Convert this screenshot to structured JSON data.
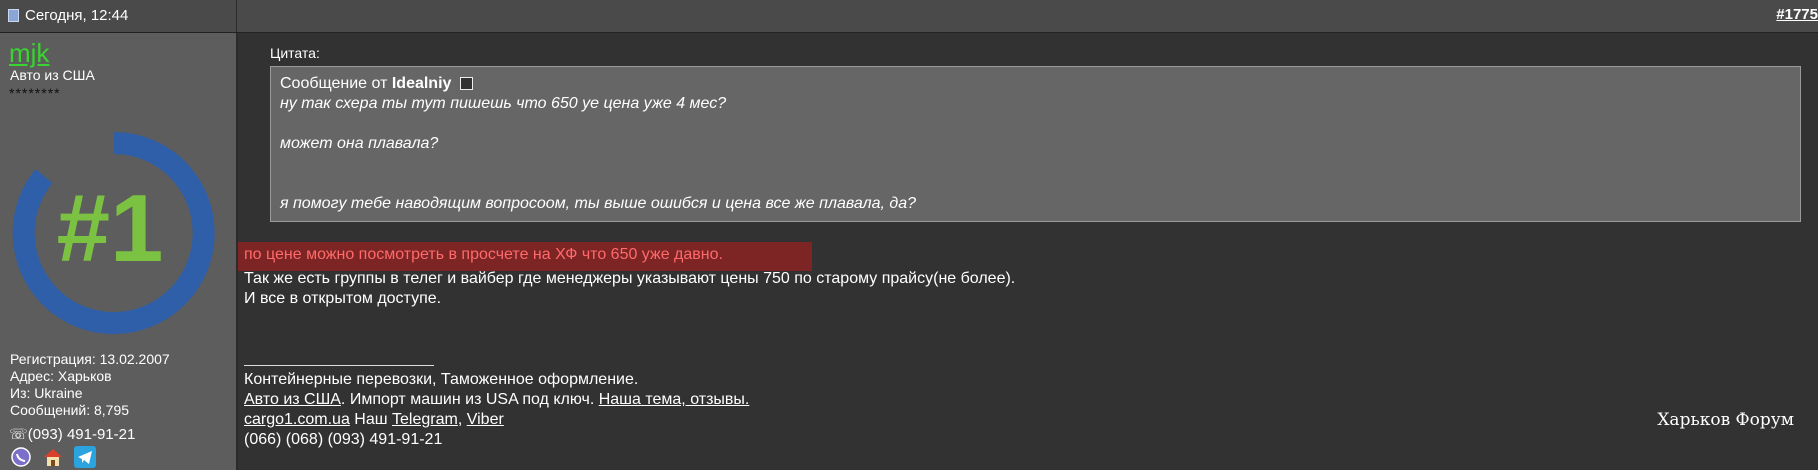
{
  "header": {
    "date": "Сегодня, 12:44",
    "post_number": "#1775"
  },
  "user": {
    "name": "mjk",
    "title": "Авто из США",
    "stars": "********",
    "avatar_text": "#1",
    "registration": "Регистрация: 13.02.2007",
    "address": "Адрес: Харьков",
    "from": "Из: Ukraine",
    "posts": "Сообщений: 8,795",
    "phone": "☏(093) 491-91-21",
    "icons": [
      "viber-icon",
      "home-icon",
      "telegram-icon"
    ]
  },
  "quote": {
    "label": "Цитата:",
    "from_prefix": "Сообщение от",
    "author": "Idealniy",
    "lines": [
      "ну так схера ты тут пишешь что 650 уе цена уже 4 мес?",
      "",
      "может она плавала?",
      "",
      "",
      "я помогу тебе наводящим вопросоом, ты выше ошибся и цена все же плавала, да?"
    ]
  },
  "post": {
    "highlight": "по цене можно посмотреть в просчете на ХФ что 650 уже давно.",
    "line2": "Так же есть группы в телег и вайбер где менеджеры указывают цены 750 по старому прайсу(не более).",
    "line3": "И все в открытом доступе."
  },
  "signature": {
    "line1": "Контейнерные перевозки, Таможенное оформление.",
    "link_auto": "Авто из США",
    "text_import": ". Импорт машин из USA под ключ. ",
    "link_topic": "Наша тема, отзывы.",
    "link_cargo": "cargo1.com.ua",
    "text_our": " Наш ",
    "link_telegram": "Telegram",
    "text_comma": ", ",
    "link_viber": "Viber",
    "phones": "(066) (068) (093) 491-91-21"
  },
  "watermark": "Харьков Форум",
  "colors": {
    "username": "#39d42f",
    "highlight_bg": "#7d2424",
    "highlight_text": "#ff6a6a",
    "avatar_ring": "#2f5fa8",
    "avatar_number": "#7cc242"
  }
}
